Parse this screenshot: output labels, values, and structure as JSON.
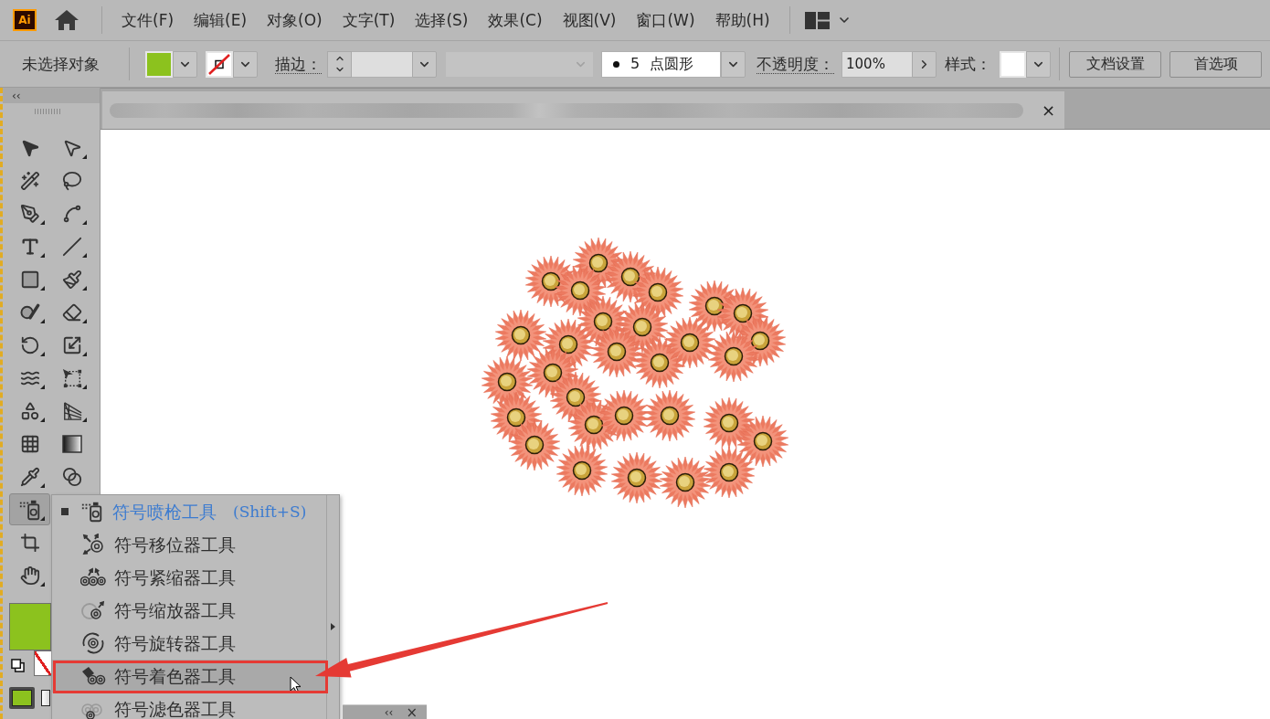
{
  "app": {
    "logo": "Ai"
  },
  "menu_bar": {
    "items": [
      "文件(F)",
      "编辑(E)",
      "对象(O)",
      "文字(T)",
      "选择(S)",
      "效果(C)",
      "视图(V)",
      "窗口(W)",
      "帮助(H)"
    ]
  },
  "control_bar": {
    "selection_label": "未选择对象",
    "fill": {
      "color": "#8cc21e"
    },
    "stroke": {
      "none": true
    },
    "stroke_label": "描边：",
    "profile_dropdown": {
      "disabled": true
    },
    "brush": "5 点圆形",
    "opacity_label": "不透明度：",
    "opacity": "100%",
    "style_label": "样式：",
    "buttons": [
      "文档设置",
      "首选项"
    ]
  },
  "tools_panel": {
    "collapse": "‹‹",
    "tool_rows": [
      [
        {
          "selected": false,
          "flyout": false
        },
        {
          "selected": false,
          "flyout": true
        }
      ],
      [
        {
          "selected": false,
          "flyout": false
        },
        {
          "selected": false,
          "flyout": false
        }
      ],
      [
        {
          "selected": false,
          "flyout": true
        },
        {
          "selected": false,
          "flyout": true
        }
      ],
      [
        {
          "selected": false,
          "flyout": true
        },
        {
          "selected": false,
          "flyout": true
        }
      ],
      [
        {
          "selected": false,
          "flyout": true
        },
        {
          "selected": false,
          "flyout": true
        }
      ],
      [
        {
          "selected": false,
          "flyout": true
        },
        {
          "selected": false,
          "flyout": true
        }
      ],
      [
        {
          "selected": false,
          "flyout": true
        },
        {
          "selected": false,
          "flyout": true
        }
      ],
      [
        {
          "selected": false,
          "flyout": true
        },
        {
          "selected": false,
          "flyout": true
        }
      ],
      [
        {
          "selected": false,
          "flyout": true
        },
        {
          "selected": false,
          "flyout": true
        }
      ],
      [
        {
          "selected": false,
          "flyout": false
        },
        {
          "selected": false,
          "flyout": false
        }
      ],
      [
        {
          "selected": false,
          "flyout": true
        },
        {
          "selected": false,
          "flyout": false
        }
      ],
      [
        {
          "selected": true,
          "flyout": true
        }
      ],
      [
        {
          "selected": false,
          "flyout": false
        }
      ],
      [
        {
          "selected": false,
          "flyout": true
        }
      ]
    ],
    "fill": {
      "color": "#8cc21e"
    },
    "stroke": {
      "none": true
    },
    "color_modes": [
      {
        "selected": true
      },
      {
        "selected": false
      }
    ]
  },
  "document_tab": {
    "close": "×"
  },
  "flyout_menu": {
    "items": [
      {
        "label": "符号喷枪工具",
        "shortcut": "(Shift+S)",
        "selected": true,
        "hovered": false,
        "annotated": false
      },
      {
        "label": "符号移位器工具",
        "selected": false,
        "hovered": false,
        "annotated": false
      },
      {
        "label": "符号紧缩器工具",
        "selected": false,
        "hovered": false,
        "annotated": false
      },
      {
        "label": "符号缩放器工具",
        "selected": false,
        "hovered": false,
        "annotated": false
      },
      {
        "label": "符号旋转器工具",
        "selected": false,
        "hovered": false,
        "annotated": false
      },
      {
        "label": "符号着色器工具",
        "selected": false,
        "hovered": true,
        "annotated": true
      },
      {
        "label": "符号滤色器工具",
        "selected": false,
        "hovered": false,
        "annotated": false
      }
    ]
  },
  "collapsed_panel": {
    "collapse": "‹‹",
    "close": "×"
  }
}
